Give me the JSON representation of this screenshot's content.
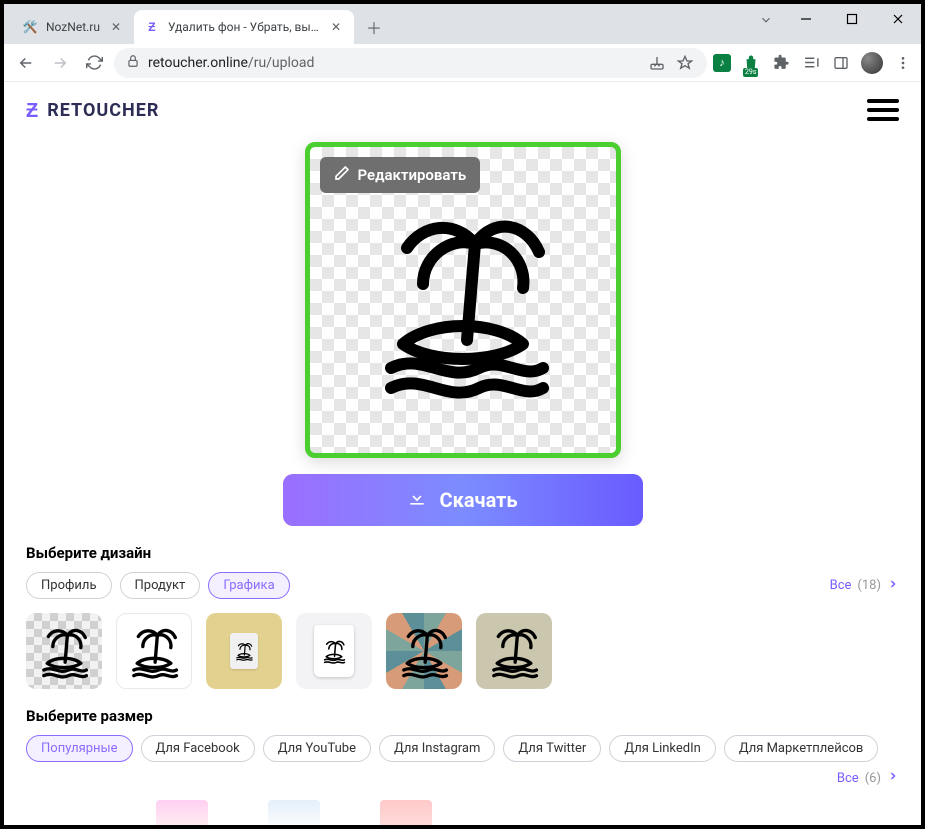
{
  "browser": {
    "tabs": [
      {
        "title": "NozNet.ru",
        "active": false
      },
      {
        "title": "Удалить фон - Убрать, вырезать",
        "active": true
      }
    ],
    "url_host": "retoucher.online",
    "url_path": "/ru/upload",
    "ext_badge": "29s"
  },
  "app": {
    "brand": "RETOUCHER",
    "edit_label": "Редактировать",
    "download_label": "Скачать"
  },
  "design": {
    "title": "Выберите дизайн",
    "chips": [
      "Профиль",
      "Продукт",
      "Графика"
    ],
    "selected_index": 2,
    "all_label": "Все",
    "all_count": "(18)"
  },
  "size": {
    "title": "Выберите размер",
    "chips": [
      "Популярные",
      "Для Facebook",
      "Для YouTube",
      "Для Instagram",
      "Для Twitter",
      "Для LinkedIn",
      "Для Маркетплейсов"
    ],
    "selected_index": 0,
    "all_label": "Все",
    "all_count": "(6)"
  }
}
